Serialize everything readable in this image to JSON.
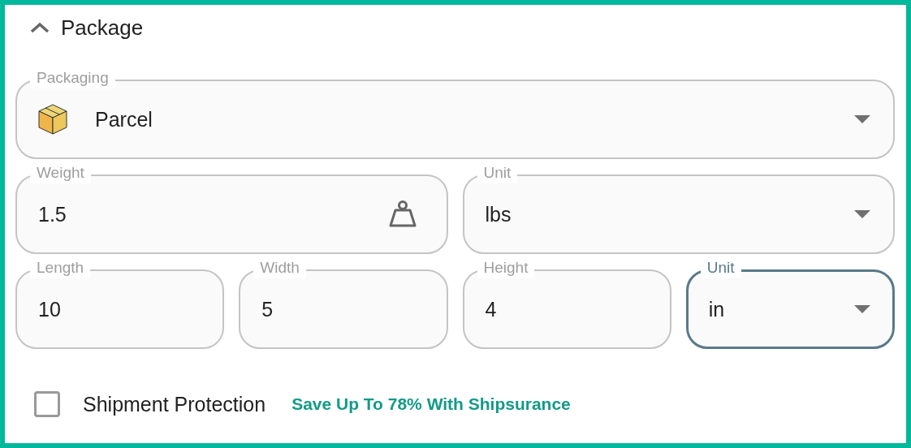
{
  "section": {
    "title": "Package",
    "expanded": true
  },
  "rows": [
    [
      {
        "kind": "icon-select",
        "label": "Packaging",
        "value": "Parcel",
        "focused": false
      }
    ],
    [
      {
        "kind": "icon-input",
        "label": "Weight",
        "value": "1.5",
        "focused": false
      },
      {
        "kind": "select",
        "label": "Unit",
        "value": "lbs",
        "focused": false
      }
    ],
    [
      {
        "kind": "input",
        "label": "Length",
        "value": "10",
        "focused": false
      },
      {
        "kind": "input",
        "label": "Width",
        "value": "5",
        "focused": false
      },
      {
        "kind": "input",
        "label": "Height",
        "value": "4",
        "focused": false
      },
      {
        "kind": "select",
        "label": "Unit",
        "value": "in",
        "focused": true
      }
    ]
  ],
  "protection": {
    "label": "Shipment Protection",
    "checked": false,
    "link": "Save Up To 78% With Shipsurance"
  }
}
